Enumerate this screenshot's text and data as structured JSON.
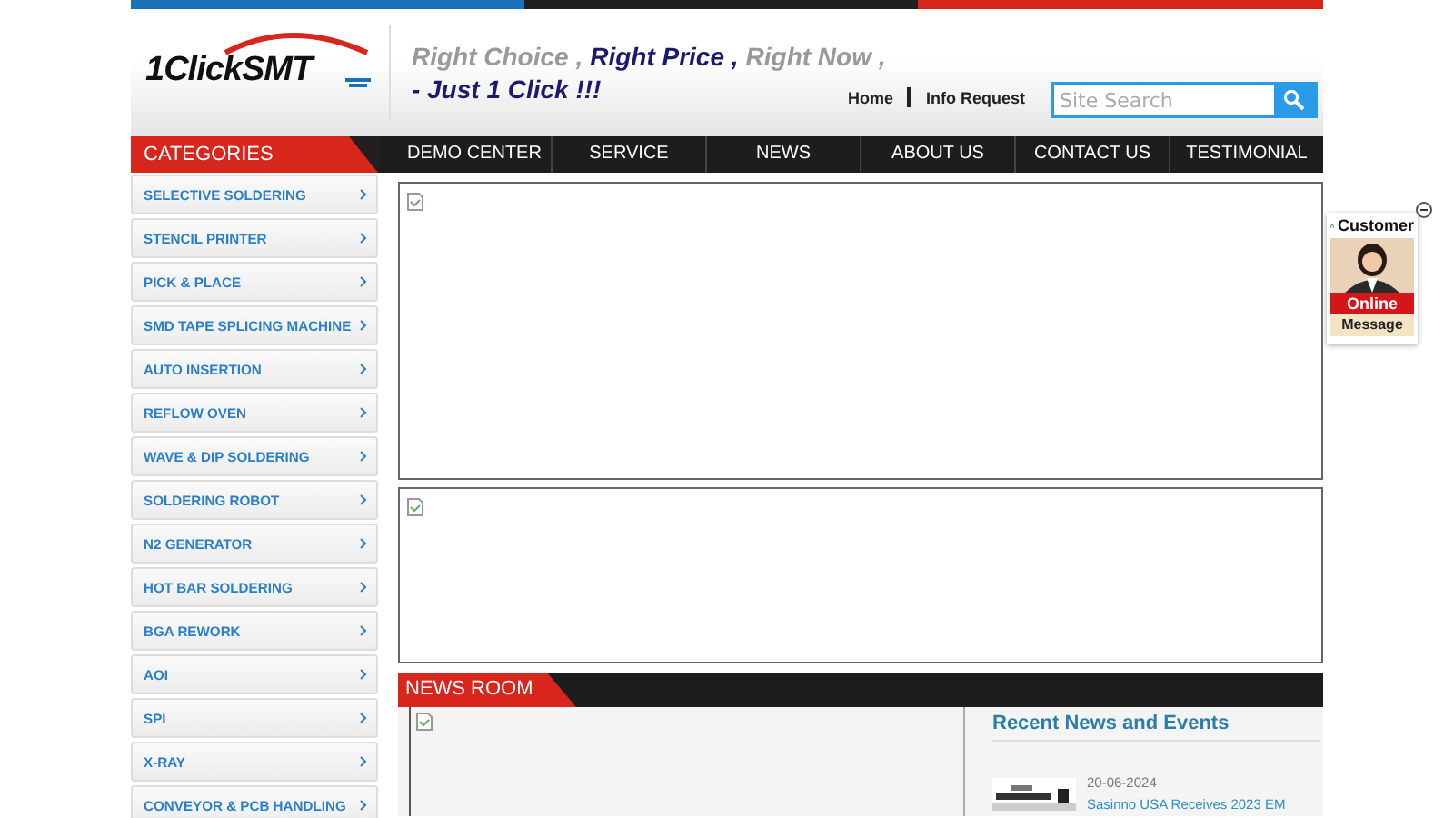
{
  "logo": {
    "part1": "1Click",
    "part2": "SMT"
  },
  "tagline": {
    "line1": [
      {
        "text": "Right Choice ,",
        "kind": "muted"
      },
      {
        "text": "Right Price ,",
        "kind": "strong"
      },
      {
        "text": "Right Now ,",
        "kind": "muted"
      }
    ],
    "line2": "- Just 1 Click !!!"
  },
  "top_links": [
    "Home",
    "Info Request"
  ],
  "search": {
    "placeholder": "Site Search"
  },
  "categories_title": "CATEGORIES",
  "nav": [
    "DEMO CENTER",
    "SERVICE",
    "NEWS",
    "ABOUT US",
    "CONTACT US",
    "TESTIMONIAL"
  ],
  "categories": [
    "SELECTIVE SOLDERING",
    "STENCIL PRINTER",
    "PICK & PLACE",
    "SMD TAPE SPLICING MACHINE",
    "AUTO INSERTION",
    "REFLOW OVEN",
    "WAVE & DIP SOLDERING",
    "SOLDERING ROBOT",
    "N2 GENERATOR",
    "HOT BAR SOLDERING",
    "BGA REWORK",
    "AOI",
    "SPI",
    "X-RAY",
    "CONVEYOR & PCB HANDLING"
  ],
  "news_room": {
    "title": "NEWS ROOM",
    "recent_title": "Recent News and Events",
    "items": [
      {
        "date": "20-06-2024",
        "title": "Sasinno USA Receives 2023 EM"
      }
    ]
  },
  "chat": {
    "title": "Customer",
    "online": "Online",
    "message": "Message"
  }
}
